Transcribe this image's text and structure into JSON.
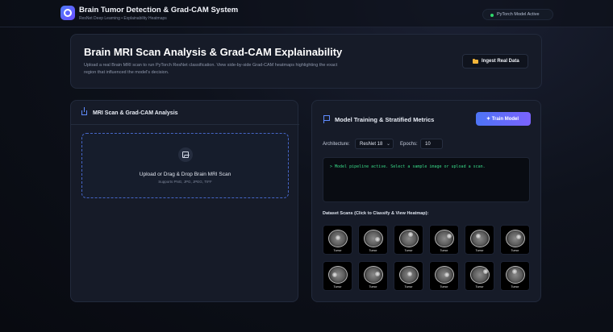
{
  "header": {
    "title": "Brain Tumor Detection & Grad-CAM System",
    "subtitle": "ResNet Deep Learning • Explainability Heatmaps",
    "status": "PyTorch Model Active",
    "status_color": "#2fd96b"
  },
  "hero": {
    "title": "Brain MRI Scan Analysis & Grad-CAM Explainability",
    "description": "Upload a real Brain MRI scan to run PyTorch ResNet classification. View side-by-side Grad-CAM heatmaps highlighting the exact region that influenced the model's decision.",
    "ingest_button": "Ingest Real Data"
  },
  "left_panel": {
    "title": "MRI Scan & Grad-CAM Analysis",
    "dropzone_title": "Upload or Drag & Drop Brain MRI Scan",
    "dropzone_sub": "Supports PNG, JPG, JPEG, TIFF"
  },
  "right_panel": {
    "title": "Model Training & Stratified Metrics",
    "train_button": "✦ Train Model",
    "architecture_label": "Architecture:",
    "architecture_value": "ResNet 18",
    "epochs_label": "Epochs:",
    "epochs_value": "10",
    "console_text": "> Model pipeline active. Select a sample image or upload a scan.",
    "dataset_label": "Dataset Scans (Click to Classify & View Heatmap):",
    "thumbnails": [
      "Tumor",
      "Tumor",
      "Tumor",
      "Tumor",
      "Tumor",
      "Tumor",
      "Tumor",
      "Tumor",
      "Tumor",
      "Tumor",
      "Tumor",
      "Tumor"
    ]
  },
  "colors": {
    "accent": "#5f8bff",
    "button_gradient_start": "#4d74f5",
    "button_gradient_end": "#7b63ff",
    "console_text": "#38d987"
  }
}
